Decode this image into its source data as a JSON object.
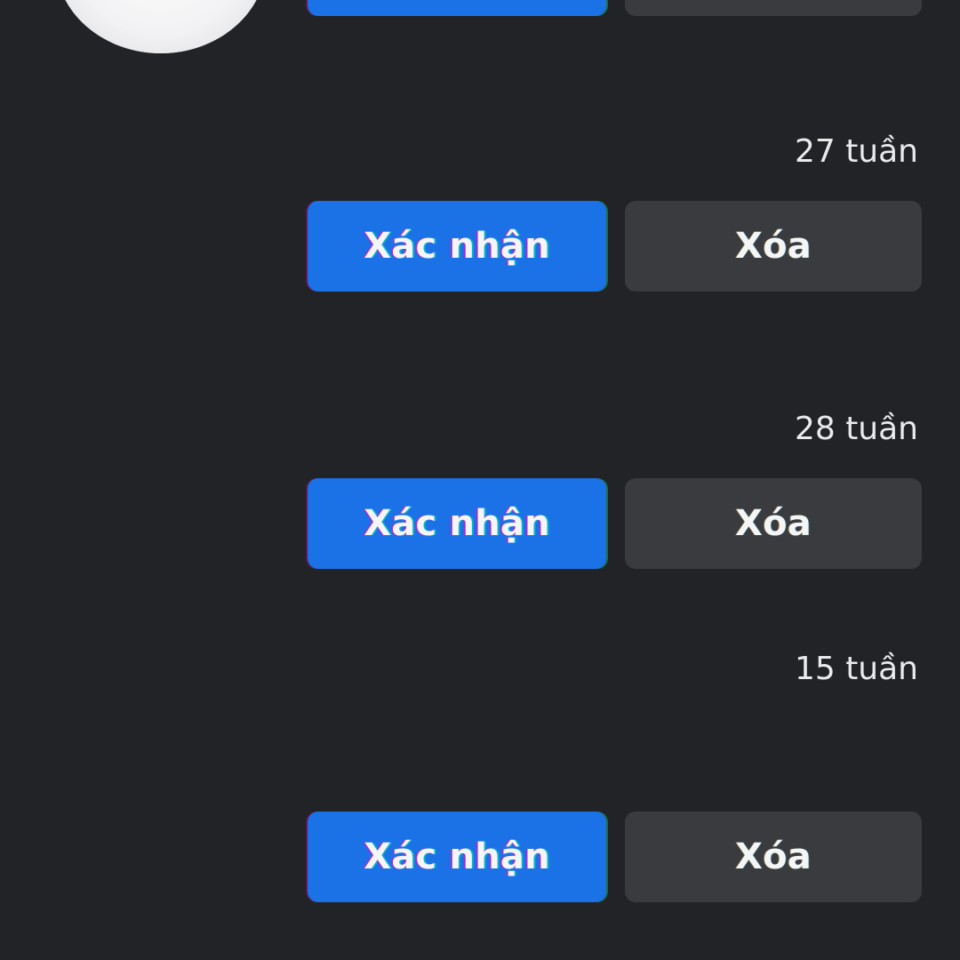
{
  "requests": [
    {
      "time": "",
      "confirm_label": "",
      "delete_label": ""
    },
    {
      "time": "27 tuần",
      "confirm_label": "Xác nhận",
      "delete_label": "Xóa"
    },
    {
      "time": "28 tuần",
      "confirm_label": "Xác nhận",
      "delete_label": "Xóa"
    },
    {
      "time": "15 tuần",
      "confirm_label": "Xác nhận",
      "delete_label": "Xóa"
    }
  ],
  "colors": {
    "background": "#222326",
    "confirm_button": "#1a72e6",
    "delete_button": "#3a3b3f",
    "text": "#f4f5f7"
  }
}
